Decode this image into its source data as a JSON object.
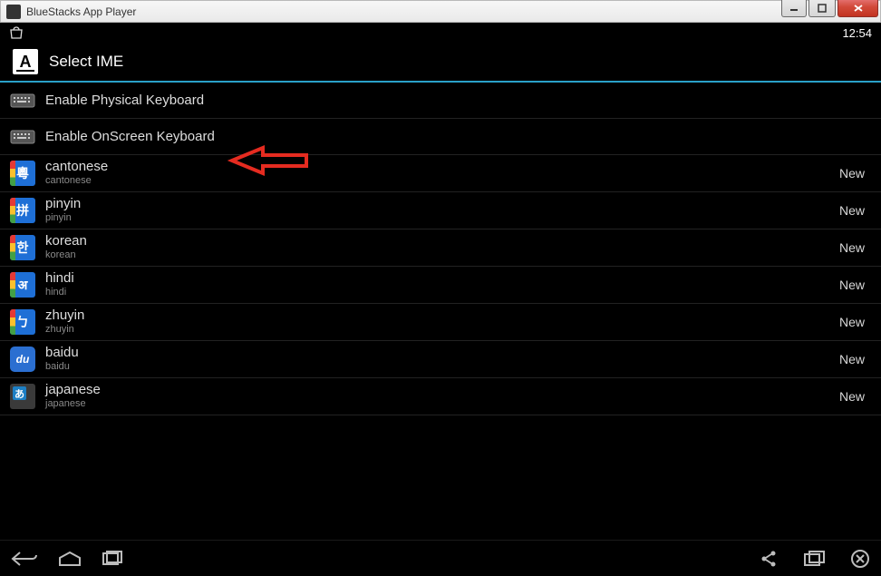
{
  "window": {
    "title": "BlueStacks App Player"
  },
  "statusbar": {
    "time": "12:54"
  },
  "header": {
    "icon_letter": "A",
    "title": "Select IME"
  },
  "keyboard_rows": [
    {
      "label": "Enable Physical Keyboard"
    },
    {
      "label": "Enable OnScreen Keyboard"
    }
  ],
  "lang_rows": [
    {
      "title": "cantonese",
      "sub": "cantonese",
      "badge": "New",
      "icon": {
        "type": "google",
        "char": "粵"
      }
    },
    {
      "title": "pinyin",
      "sub": "pinyin",
      "badge": "New",
      "icon": {
        "type": "google",
        "char": "拼"
      }
    },
    {
      "title": "korean",
      "sub": "korean",
      "badge": "New",
      "icon": {
        "type": "google",
        "char": "한"
      }
    },
    {
      "title": "hindi",
      "sub": "hindi",
      "badge": "New",
      "icon": {
        "type": "google",
        "char": "अ"
      }
    },
    {
      "title": "zhuyin",
      "sub": "zhuyin",
      "badge": "New",
      "icon": {
        "type": "google",
        "char": "ㄅ"
      }
    },
    {
      "title": "baidu",
      "sub": "baidu",
      "badge": "New",
      "icon": {
        "type": "baidu",
        "char": "du"
      }
    },
    {
      "title": "japanese",
      "sub": "japanese",
      "badge": "New",
      "icon": {
        "type": "jp",
        "char": "あ"
      }
    }
  ]
}
